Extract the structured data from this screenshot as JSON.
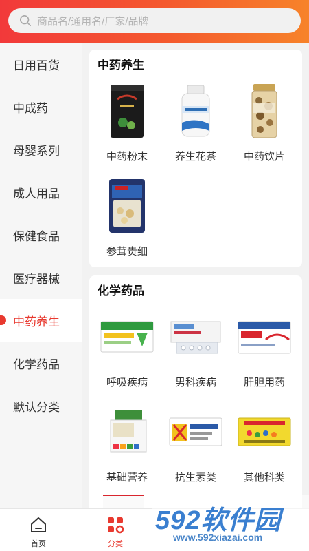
{
  "search": {
    "placeholder": "商品名/通用名/厂家/品牌"
  },
  "sidebar": {
    "items": [
      {
        "label": "日用百货"
      },
      {
        "label": "中成药"
      },
      {
        "label": "母婴系列"
      },
      {
        "label": "成人用品"
      },
      {
        "label": "保健食品"
      },
      {
        "label": "医疗器械"
      },
      {
        "label": "中药养生",
        "active": true
      },
      {
        "label": "化学药品"
      },
      {
        "label": "默认分类"
      }
    ]
  },
  "sections": [
    {
      "title": "中药养生",
      "items": [
        {
          "label": "中药粉末",
          "icon": "black-herbal-tin-image"
        },
        {
          "label": "养生花茶",
          "icon": "white-bottle-image"
        },
        {
          "label": "中药饮片",
          "icon": "herbal-slices-jar-image"
        },
        {
          "label": "参茸贵细",
          "icon": "ginseng-bag-image"
        }
      ]
    },
    {
      "title": "化学药品",
      "items": [
        {
          "label": "呼吸疾病",
          "icon": "green-medicine-box-image"
        },
        {
          "label": "男科疾病",
          "icon": "blister-pack-image"
        },
        {
          "label": "肝胆用药",
          "icon": "red-medicine-box-image"
        },
        {
          "label": "基础营养",
          "icon": "centrum-box-image"
        },
        {
          "label": "抗生素类",
          "icon": "colorful-medicine-box-image"
        },
        {
          "label": "其他科类",
          "icon": "yellow-medicine-box-image"
        }
      ]
    }
  ],
  "tabbar": {
    "items": [
      {
        "label": "首页",
        "icon": "home-icon"
      },
      {
        "label": "分类",
        "icon": "category-icon",
        "active": true
      }
    ]
  },
  "watermark": {
    "main": "592软件园",
    "url": "www.592xiazai.com"
  },
  "colors": {
    "accent": "#e8392f",
    "header_start": "#f2393a",
    "header_end": "#f7832a"
  }
}
